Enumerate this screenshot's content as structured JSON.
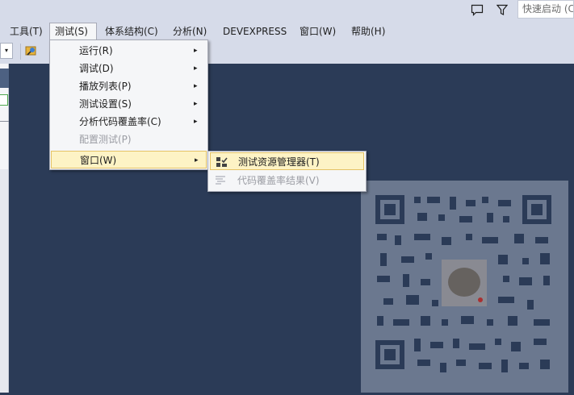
{
  "titlebar": {
    "feedback_icon": "speech-bubble-icon",
    "filter_icon": "funnel-icon",
    "quick_launch_placeholder": "快速启动 (C"
  },
  "menubar": {
    "items": [
      {
        "label": "工具(T)"
      },
      {
        "label": "测试(S)"
      },
      {
        "label": "体系结构(C)"
      },
      {
        "label": "分析(N)"
      },
      {
        "label": "DEVEXPRESS"
      },
      {
        "label": "窗口(W)"
      },
      {
        "label": "帮助(H)"
      }
    ]
  },
  "test_menu": {
    "items": [
      {
        "label": "运行(R)",
        "arrow": "▸"
      },
      {
        "label": "调试(D)",
        "arrow": "▸"
      },
      {
        "label": "播放列表(P)",
        "arrow": "▸"
      },
      {
        "label": "测试设置(S)",
        "arrow": "▸"
      },
      {
        "label": "分析代码覆盖率(C)",
        "arrow": "▸"
      },
      {
        "label": "配置测试(P)",
        "disabled": true
      },
      {
        "label": "窗口(W)",
        "arrow": "▸",
        "highlighted": true
      }
    ]
  },
  "window_submenu": {
    "items": [
      {
        "label": "测试资源管理器(T)",
        "icon": "test-explorer-icon",
        "highlighted": true
      },
      {
        "label": "代码覆盖率结果(V)",
        "icon": "code-coverage-icon",
        "disabled": true
      }
    ]
  },
  "toolbar": {
    "combo_arrow": "▾",
    "find_icon": "find-in-files-icon"
  },
  "colors": {
    "chrome": "#d6dbe9",
    "workspace": "#2b3b57",
    "highlight": "#fdf3c5",
    "highlight_border": "#e5c365"
  }
}
